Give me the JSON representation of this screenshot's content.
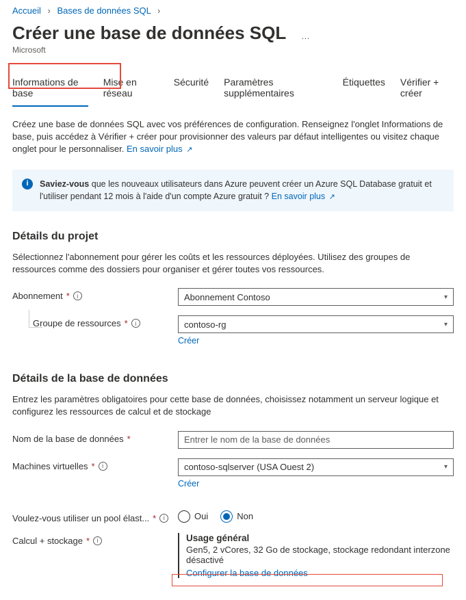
{
  "breadcrumb": {
    "home": "Accueil",
    "parent": "Bases de données SQL"
  },
  "page": {
    "title": "Créer une base de données SQL",
    "subtitle": "Microsoft"
  },
  "tabs": {
    "basics": "Informations de base",
    "networking": "Mise en réseau",
    "security": "Sécurité",
    "additional": "Paramètres supplémentaires",
    "tags": "Étiquettes",
    "review": "Vérifier + créer"
  },
  "intro": {
    "text": "Créez une base de données SQL avec vos préférences de configuration. Renseignez l'onglet Informations de base, puis accédez à Vérifier + créer pour provisionner des valeurs par défaut intelligentes ou visitez chaque onglet pour le personnaliser. ",
    "link": "En savoir plus"
  },
  "infobox": {
    "bold": "Saviez-vous",
    "text": " que les nouveaux utilisateurs dans Azure peuvent créer un Azure SQL Database gratuit et l'utiliser pendant 12 mois à l'aide d'un compte Azure gratuit ? ",
    "link": "En savoir plus"
  },
  "project": {
    "heading": "Détails du projet",
    "desc": "Sélectionnez l'abonnement pour gérer les coûts et les ressources déployées. Utilisez des groupes de ressources comme des dossiers pour organiser et gérer toutes vos ressources.",
    "subscription_label": "Abonnement",
    "subscription_value": "Abonnement Contoso",
    "rg_label": "Groupe de ressources",
    "rg_value": "contoso-rg",
    "create_link": "Créer"
  },
  "database": {
    "heading": "Détails de la base de données",
    "desc": "Entrez les paramètres obligatoires pour cette base de données, choisissez notamment un serveur logique et configurez les ressources de calcul et de stockage",
    "name_label": "Nom de la base de données",
    "name_placeholder": "Entrer le nom de la base de données",
    "server_label": "Machines virtuelles",
    "server_value": "contoso-sqlserver (USA Ouest 2)",
    "create_link": "Créer",
    "pool_label": "Voulez-vous utiliser un pool élast...",
    "pool_yes": "Oui",
    "pool_no": "Non",
    "compute_label": "Calcul + stockage",
    "compute_tier": "Usage général",
    "compute_detail": "Gen5, 2 vCores, 32 Go de stockage, stockage redondant interzone désactivé",
    "configure_link": "Configurer la base de données"
  }
}
